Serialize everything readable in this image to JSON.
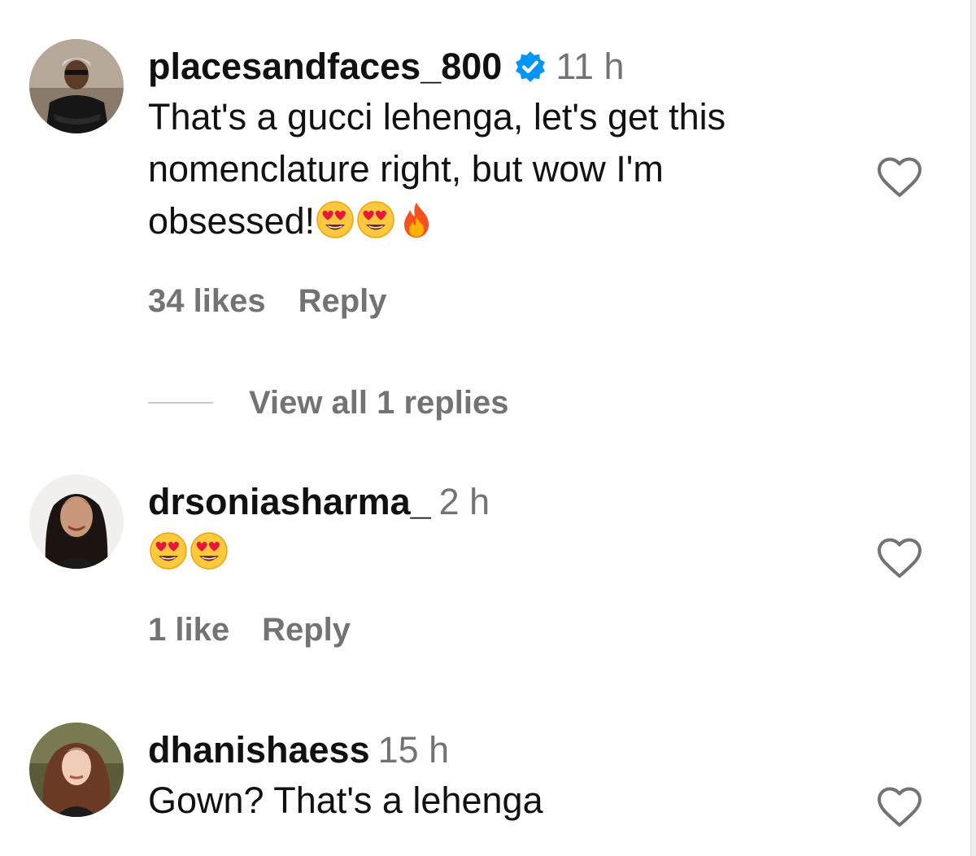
{
  "comments": [
    {
      "username": "placesandfaces_800",
      "verified": true,
      "time": "11 h",
      "text_lines": [
        "That's a gucci lehenga, let's get this",
        "nomenclature right, but wow I'm",
        "obsessed!"
      ],
      "text_emojis": [
        "heart-eyes",
        "heart-eyes",
        "fire"
      ],
      "likes": "34 likes",
      "reply_label": "Reply",
      "view_replies": "View all 1 replies"
    },
    {
      "username": "drsoniasharma_",
      "verified": false,
      "time": "2 h",
      "text_emojis": [
        "heart-eyes",
        "heart-eyes"
      ],
      "likes": "1 like",
      "reply_label": "Reply"
    },
    {
      "username": "dhanishaess",
      "verified": false,
      "time": "15 h",
      "text_lines": [
        "Gown? That's a lehenga"
      ]
    }
  ],
  "icons": {
    "verified_badge": "verified-badge-icon",
    "like": "heart-outline-icon"
  },
  "colors": {
    "verified_blue": "#0095F6",
    "muted_text": "#737373",
    "primary_text": "#111111"
  }
}
